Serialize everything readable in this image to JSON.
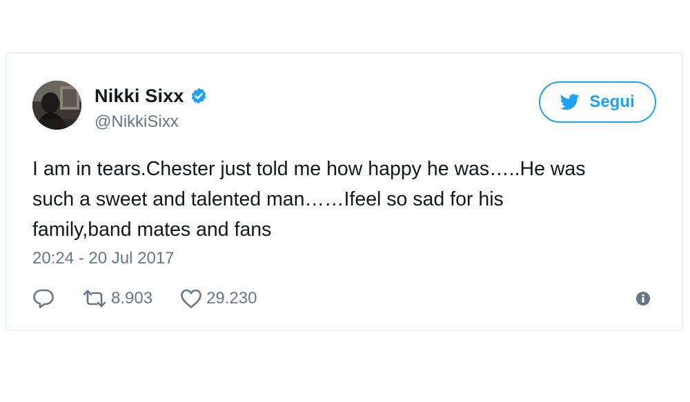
{
  "tweet": {
    "author": {
      "name": "Nikki Sixx",
      "handle": "@NikkiSixx",
      "verified": true
    },
    "follow_button": {
      "label": "Segui",
      "icon": "twitter-bird-icon"
    },
    "text_lines": [
      "I am in tears.Chester just told me how happy he was…..He was",
      "such a sweet and talented man……Ifeel so sad for his",
      "family,band mates and fans"
    ],
    "timestamp": "20:24 - 20 Jul 2017",
    "actions": {
      "reply_icon": "reply-icon",
      "retweet_icon": "retweet-icon",
      "retweet_count": "8.903",
      "like_icon": "heart-icon",
      "like_count": "29.230",
      "info_icon": "info-icon"
    },
    "colors": {
      "accent": "#1da1f2",
      "muted": "#657786",
      "text": "#14171a",
      "border": "#e1e8ed"
    }
  }
}
